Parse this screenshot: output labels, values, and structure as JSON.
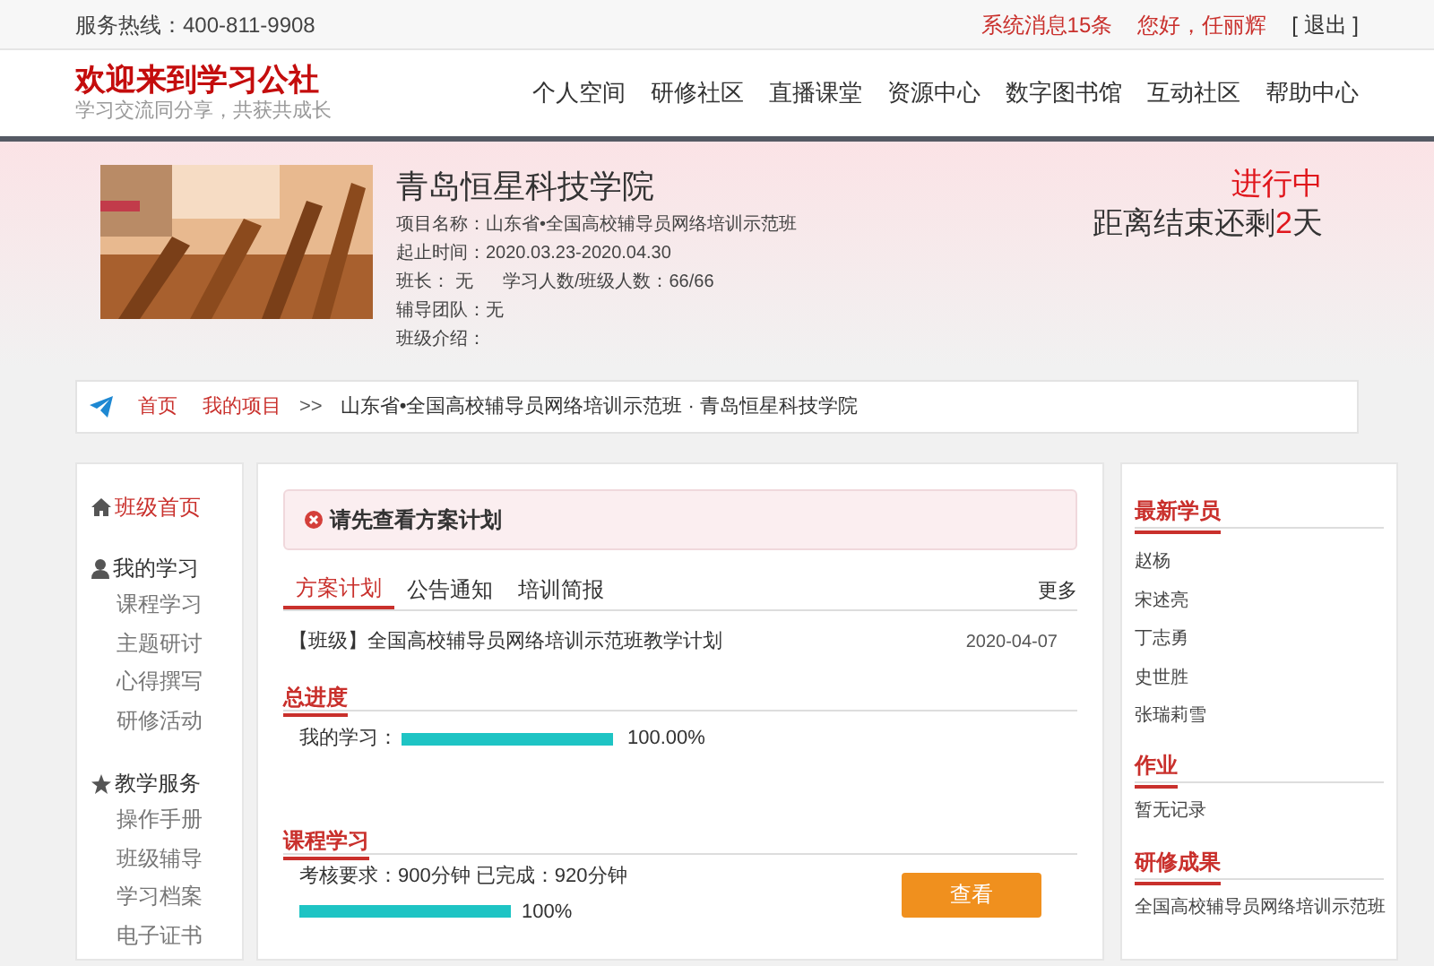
{
  "top_bar": {
    "hotline": "服务热线：400-811-9908",
    "messages": "系统消息15条",
    "greeting": "您好，任丽辉",
    "logout": "[ 退出 ]"
  },
  "header": {
    "title": "欢迎来到学习公社",
    "slogan": "学习交流同分享，共获共成长",
    "nav": [
      "个人空间",
      "研修社区",
      "直播课堂",
      "资源中心",
      "数字图书馆",
      "互动社区",
      "帮助中心"
    ]
  },
  "banner": {
    "name": "青岛恒星科技学院",
    "fields": [
      "项目名称：山东省•全国高校辅导员网络培训示范班",
      "起止时间：2020.03.23-2020.04.30",
      "班长： 无      学习人数/班级人数：66/66",
      "辅导团队：无",
      "班级介绍："
    ],
    "status": "进行中",
    "countdown_before": "距离结束还剩",
    "countdown_days": "2",
    "countdown_after": "天"
  },
  "breadcrumb": {
    "links": [
      "首页",
      "我的项目"
    ],
    "separator": ">>",
    "current": "山东省•全国高校辅导员网络培训示范班 · 青岛恒星科技学院"
  },
  "sidebar": {
    "sections": [
      {
        "label": "班级首页",
        "selected": true
      },
      {
        "label": "我的学习",
        "selected": false,
        "items": [
          "课程学习",
          "主题研讨",
          "心得撰写",
          "研修活动"
        ]
      },
      {
        "label": "教学服务",
        "selected": false,
        "items": [
          "操作手册",
          "班级辅导",
          "学习档案",
          "电子证书"
        ]
      }
    ]
  },
  "alert": "请先查看方案计划",
  "tabs": [
    {
      "label": "方案计划",
      "selected": true
    },
    {
      "label": "公告通知",
      "selected": false
    },
    {
      "label": "培训简报",
      "selected": false
    }
  ],
  "more": "更多",
  "plans": [
    {
      "title": "【班级】全国高校辅导员网络培训示范班教学计划",
      "date": "2020-04-07"
    }
  ],
  "progress": {
    "heading": "总进度",
    "label": "我的学习：",
    "level": 1,
    "reading": "100.00%"
  },
  "course": {
    "heading": "课程学习",
    "requirement": "考核要求：900分钟 已完成：920分钟",
    "level": 1,
    "reading": "100%",
    "button": "查看"
  },
  "right": {
    "students": {
      "heading": "最新学员",
      "names": [
        "赵杨",
        "宋述亮",
        "丁志勇",
        "史世胜",
        "张瑞莉雪"
      ]
    },
    "homework": {
      "heading": "作业",
      "empty": "暂无记录"
    },
    "results": {
      "heading": "研修成果",
      "items": [
        "全国高校辅导员网络培训示范班"
      ]
    }
  }
}
